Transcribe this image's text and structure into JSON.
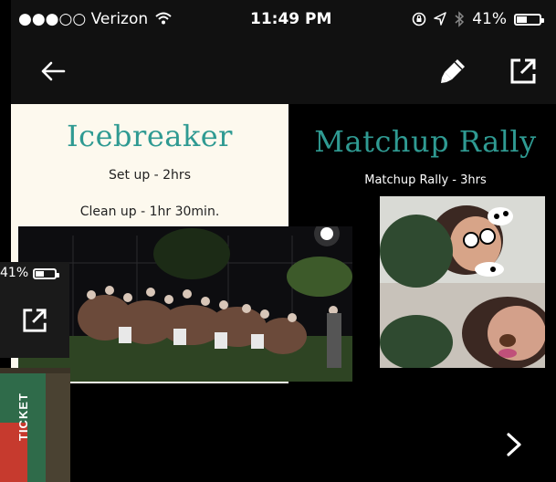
{
  "status_bar": {
    "carrier": "●●●○○ Verizon",
    "time": "11:49 PM",
    "battery": "41%",
    "battery_level": 0.41
  },
  "toolbar": {
    "back_icon": "arrow-left-icon",
    "edit_icon": "marker-icon",
    "open_icon": "open-external-icon"
  },
  "cards": {
    "icebreaker": {
      "title": "Icebreaker",
      "line1": "Set up - 2hrs",
      "line2": "Clean up - 1hr 30min.",
      "title_color": "#2f9a92"
    },
    "matchup": {
      "title": "Matchup Rally",
      "line1": "Matchup Rally - 3hrs",
      "title_color": "#2f9a92"
    }
  },
  "overlay": {
    "battery": "41%",
    "open_icon": "open-external-icon",
    "ticket_text": "TICKET"
  },
  "next_icon": "chevron-right-icon"
}
